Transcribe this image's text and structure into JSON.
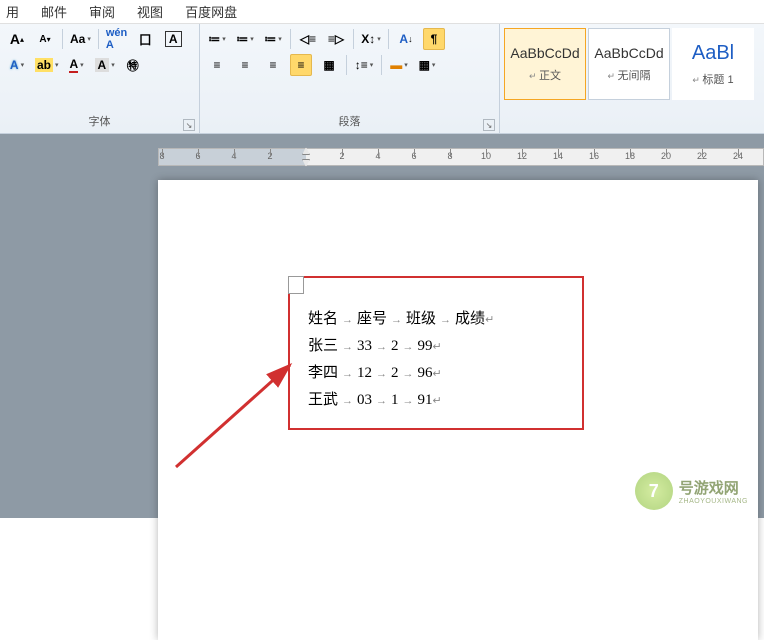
{
  "menu": {
    "items": [
      "用",
      "邮件",
      "审阅",
      "视图",
      "百度网盘"
    ]
  },
  "ribbon": {
    "font": {
      "label": "字体",
      "grow": "A",
      "shrink": "A",
      "case": "Aa",
      "pinyin": "拼",
      "border": "囗",
      "charbox": "A",
      "effects": "A",
      "highlight": "ab",
      "fontcolor": "A",
      "charshade": "A",
      "enclose": "㊕"
    },
    "paragraph": {
      "label": "段落",
      "bullets": "•",
      "numbers": "1",
      "multilevel": "≡",
      "dec_indent": "◁",
      "inc_indent": "▷",
      "sort": "A↓",
      "cjk": "X",
      "show_marks": "¶",
      "align_l": "≡",
      "align_c": "≡",
      "align_r": "≡",
      "justify": "≡",
      "distribute": "▦",
      "spacing": "↕",
      "shading": "▬",
      "borders": "▦"
    },
    "styles": [
      {
        "preview": "AaBbCcDd",
        "name": "正文"
      },
      {
        "preview": "AaBbCcDd",
        "name": "无间隔"
      },
      {
        "preview": "AaBl",
        "name": "标题 1"
      }
    ]
  },
  "ruler": {
    "values": [
      "8",
      "6",
      "4",
      "2",
      "",
      "2",
      "4",
      "6",
      "8",
      "10",
      "12",
      "14",
      "16",
      "18",
      "20",
      "22",
      "24"
    ]
  },
  "document": {
    "header": [
      "姓名",
      "座号",
      "班级",
      "成绩"
    ],
    "rows": [
      [
        "张三",
        "33",
        "2",
        "99"
      ],
      [
        "李四",
        "12",
        "2",
        "96"
      ],
      [
        "王武",
        "03",
        "1",
        "91"
      ]
    ]
  },
  "watermark": {
    "badge": "7",
    "name": "号游戏网",
    "pinyin": "ZHAOYOUXIWANG"
  }
}
